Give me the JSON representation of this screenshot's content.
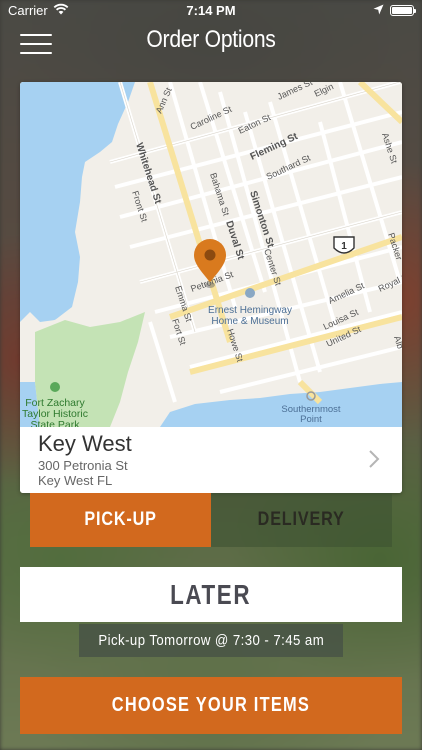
{
  "status_bar": {
    "carrier": "Carrier",
    "time": "7:14 PM",
    "wifi_icon": "wifi-icon",
    "location_icon": "location-arrow-icon",
    "battery_level": 1.0
  },
  "nav": {
    "title": "Order Options",
    "menu_icon": "hamburger-menu-icon"
  },
  "map": {
    "streets": [
      "Ann St",
      "Caroline St",
      "Eaton St",
      "James St",
      "Elgin",
      "Whitehead St",
      "Fleming St",
      "Southard St",
      "Bahama St",
      "Front St",
      "Simonton St",
      "Duval St",
      "Petronia St",
      "Center St",
      "Emma St",
      "Fort St",
      "Howe St",
      "Amelia St",
      "Louisa St",
      "United St",
      "Royal St",
      "Packer",
      "Ashe St",
      "Alb"
    ],
    "landmarks": {
      "museum": [
        "Ernest Hemingway",
        "Home & Museum"
      ],
      "park": [
        "Fort Zachary",
        "Taylor Historic",
        "State Park"
      ],
      "point": [
        "Southernmost",
        "Point"
      ]
    },
    "highway_shield": "1",
    "pin_icon": "map-pin-icon",
    "colors": {
      "water": "#a6d1f2",
      "land": "#f2efe9",
      "park": "#c4e3b5",
      "major_road": "#f8e39e",
      "pin": "#d97a1e"
    }
  },
  "location": {
    "name": "Key West",
    "address_line1": "300 Petronia St",
    "address_line2": "Key West FL"
  },
  "order_type": {
    "pickup_label": "PICK-UP",
    "delivery_label": "DELIVERY",
    "selected": "pickup"
  },
  "timing": {
    "later_label": "LATER",
    "pickup_time": "Pick-up Tomorrow @ 7:30 - 7:45 am"
  },
  "cta": {
    "choose_items_label": "CHOOSE YOUR ITEMS"
  },
  "colors": {
    "accent": "#d2691e",
    "white": "#ffffff"
  }
}
